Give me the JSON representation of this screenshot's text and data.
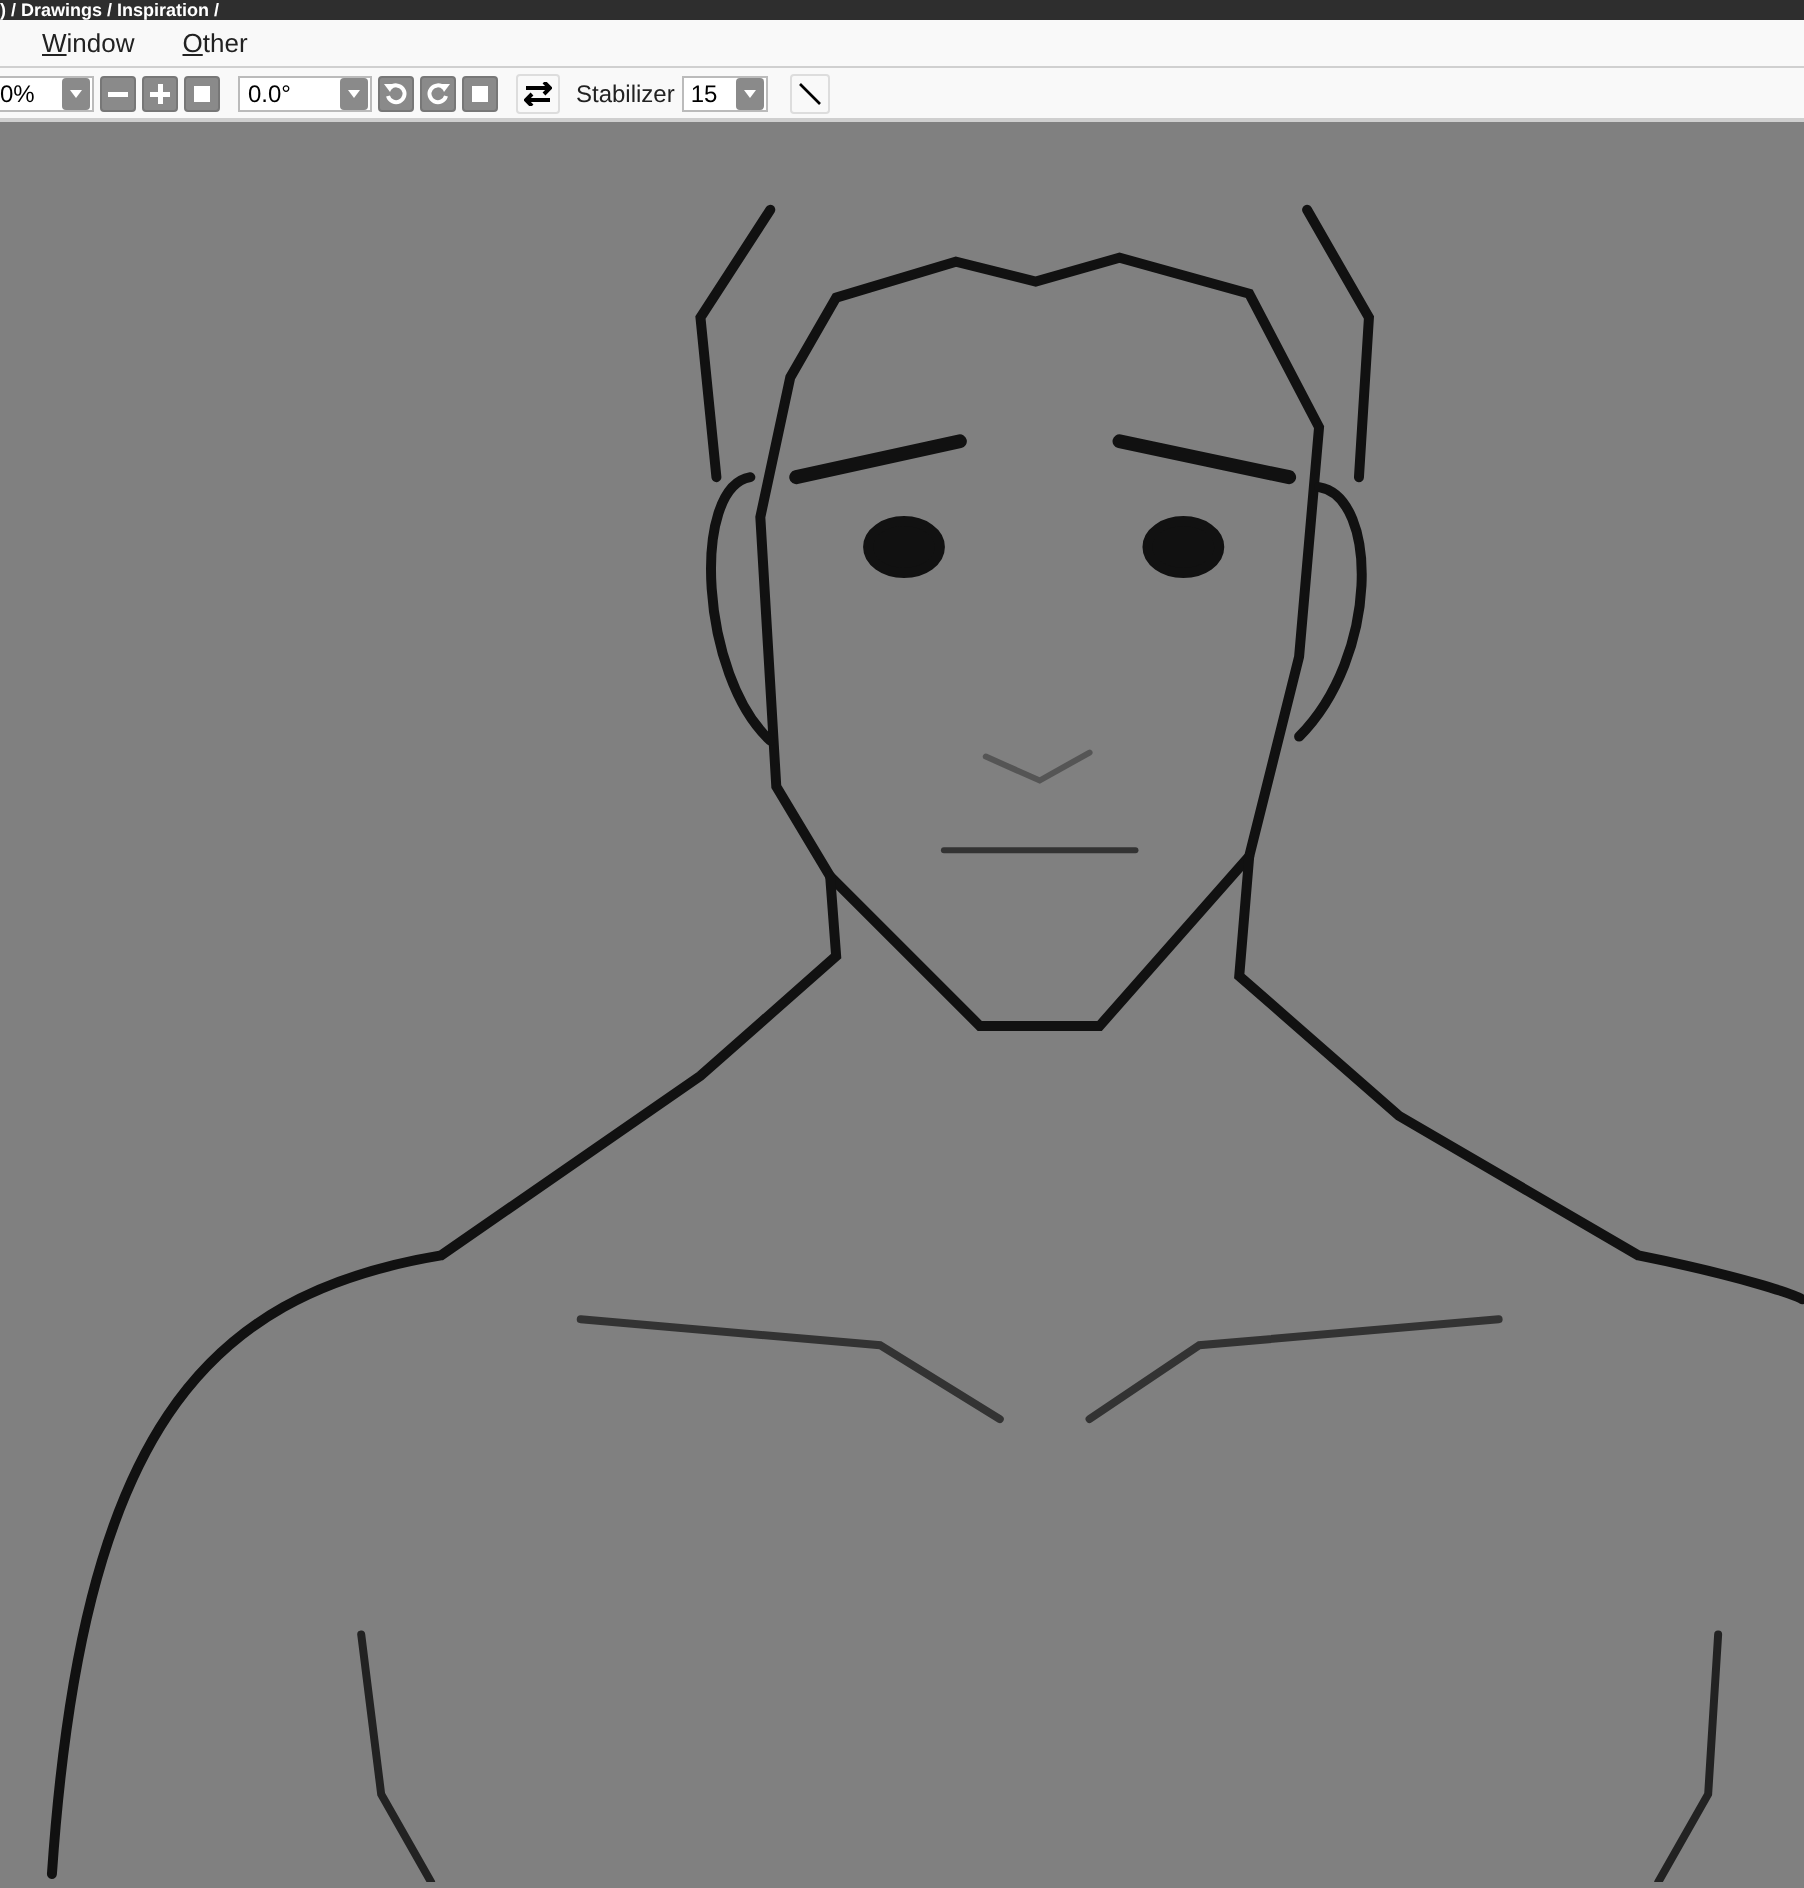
{
  "window": {
    "title": ") / Drawings / Inspiration /"
  },
  "menu": [
    {
      "label": "Window"
    },
    {
      "label": "Other"
    }
  ],
  "toolbar": {
    "zoom": "0%",
    "angle": "0.0°",
    "stabilizer_label": "Stabilizer",
    "stabilizer": "15"
  }
}
